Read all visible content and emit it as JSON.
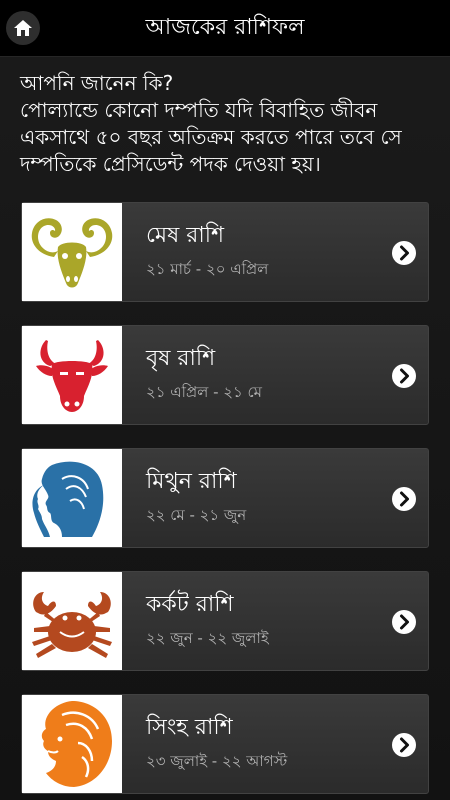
{
  "app_title": "আজকের রাশিফল",
  "fact": {
    "heading": "আপনি জানেন কি?",
    "body": "পোল্যান্ডে কোনো দম্পতি যদি বিবাহিত জীবন একসাথে ৫০ বছর অতিক্রম করতে পারে তবে সে দম্পতিকে প্রেসিডেন্ট পদক দেওয়া হয়।"
  },
  "signs": [
    {
      "name": "মেষ রাশি",
      "dates": "২১ মার্চ - ২০ এপ্রিল",
      "icon": "aries-ram-icon",
      "color": "#aaa629"
    },
    {
      "name": "বৃষ রাশি",
      "dates": "২১ এপ্রিল - ২১ মে",
      "icon": "taurus-bull-icon",
      "color": "#d8212f"
    },
    {
      "name": "মিথুন রাশি",
      "dates": "২২ মে - ২১ জুন",
      "icon": "gemini-twins-icon",
      "color": "#2a71a7"
    },
    {
      "name": "কর্কট রাশি",
      "dates": "২২ জুন - ২২ জুলাই",
      "icon": "cancer-crab-icon",
      "color": "#b4491f"
    },
    {
      "name": "সিংহ রাশি",
      "dates": "২৩ জুলাই - ২২ আগস্ট",
      "icon": "leo-lion-icon",
      "color": "#ef7d1a"
    }
  ]
}
